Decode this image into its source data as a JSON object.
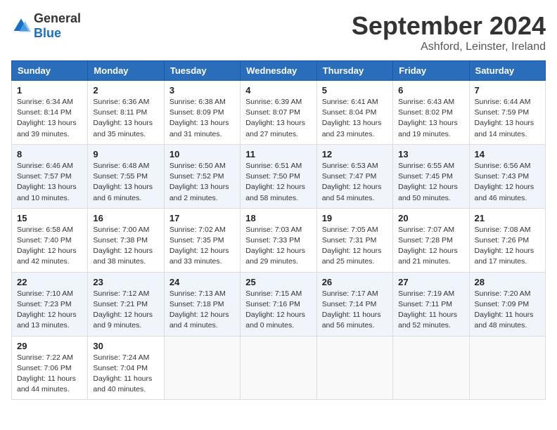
{
  "header": {
    "logo_general": "General",
    "logo_blue": "Blue",
    "title": "September 2024",
    "location": "Ashford, Leinster, Ireland"
  },
  "calendar": {
    "days_of_week": [
      "Sunday",
      "Monday",
      "Tuesday",
      "Wednesday",
      "Thursday",
      "Friday",
      "Saturday"
    ],
    "weeks": [
      [
        {
          "day": "1",
          "info": "Sunrise: 6:34 AM\nSunset: 8:14 PM\nDaylight: 13 hours\nand 39 minutes."
        },
        {
          "day": "2",
          "info": "Sunrise: 6:36 AM\nSunset: 8:11 PM\nDaylight: 13 hours\nand 35 minutes."
        },
        {
          "day": "3",
          "info": "Sunrise: 6:38 AM\nSunset: 8:09 PM\nDaylight: 13 hours\nand 31 minutes."
        },
        {
          "day": "4",
          "info": "Sunrise: 6:39 AM\nSunset: 8:07 PM\nDaylight: 13 hours\nand 27 minutes."
        },
        {
          "day": "5",
          "info": "Sunrise: 6:41 AM\nSunset: 8:04 PM\nDaylight: 13 hours\nand 23 minutes."
        },
        {
          "day": "6",
          "info": "Sunrise: 6:43 AM\nSunset: 8:02 PM\nDaylight: 13 hours\nand 19 minutes."
        },
        {
          "day": "7",
          "info": "Sunrise: 6:44 AM\nSunset: 7:59 PM\nDaylight: 13 hours\nand 14 minutes."
        }
      ],
      [
        {
          "day": "8",
          "info": "Sunrise: 6:46 AM\nSunset: 7:57 PM\nDaylight: 13 hours\nand 10 minutes."
        },
        {
          "day": "9",
          "info": "Sunrise: 6:48 AM\nSunset: 7:55 PM\nDaylight: 13 hours\nand 6 minutes."
        },
        {
          "day": "10",
          "info": "Sunrise: 6:50 AM\nSunset: 7:52 PM\nDaylight: 13 hours\nand 2 minutes."
        },
        {
          "day": "11",
          "info": "Sunrise: 6:51 AM\nSunset: 7:50 PM\nDaylight: 12 hours\nand 58 minutes."
        },
        {
          "day": "12",
          "info": "Sunrise: 6:53 AM\nSunset: 7:47 PM\nDaylight: 12 hours\nand 54 minutes."
        },
        {
          "day": "13",
          "info": "Sunrise: 6:55 AM\nSunset: 7:45 PM\nDaylight: 12 hours\nand 50 minutes."
        },
        {
          "day": "14",
          "info": "Sunrise: 6:56 AM\nSunset: 7:43 PM\nDaylight: 12 hours\nand 46 minutes."
        }
      ],
      [
        {
          "day": "15",
          "info": "Sunrise: 6:58 AM\nSunset: 7:40 PM\nDaylight: 12 hours\nand 42 minutes."
        },
        {
          "day": "16",
          "info": "Sunrise: 7:00 AM\nSunset: 7:38 PM\nDaylight: 12 hours\nand 38 minutes."
        },
        {
          "day": "17",
          "info": "Sunrise: 7:02 AM\nSunset: 7:35 PM\nDaylight: 12 hours\nand 33 minutes."
        },
        {
          "day": "18",
          "info": "Sunrise: 7:03 AM\nSunset: 7:33 PM\nDaylight: 12 hours\nand 29 minutes."
        },
        {
          "day": "19",
          "info": "Sunrise: 7:05 AM\nSunset: 7:31 PM\nDaylight: 12 hours\nand 25 minutes."
        },
        {
          "day": "20",
          "info": "Sunrise: 7:07 AM\nSunset: 7:28 PM\nDaylight: 12 hours\nand 21 minutes."
        },
        {
          "day": "21",
          "info": "Sunrise: 7:08 AM\nSunset: 7:26 PM\nDaylight: 12 hours\nand 17 minutes."
        }
      ],
      [
        {
          "day": "22",
          "info": "Sunrise: 7:10 AM\nSunset: 7:23 PM\nDaylight: 12 hours\nand 13 minutes."
        },
        {
          "day": "23",
          "info": "Sunrise: 7:12 AM\nSunset: 7:21 PM\nDaylight: 12 hours\nand 9 minutes."
        },
        {
          "day": "24",
          "info": "Sunrise: 7:13 AM\nSunset: 7:18 PM\nDaylight: 12 hours\nand 4 minutes."
        },
        {
          "day": "25",
          "info": "Sunrise: 7:15 AM\nSunset: 7:16 PM\nDaylight: 12 hours\nand 0 minutes."
        },
        {
          "day": "26",
          "info": "Sunrise: 7:17 AM\nSunset: 7:14 PM\nDaylight: 11 hours\nand 56 minutes."
        },
        {
          "day": "27",
          "info": "Sunrise: 7:19 AM\nSunset: 7:11 PM\nDaylight: 11 hours\nand 52 minutes."
        },
        {
          "day": "28",
          "info": "Sunrise: 7:20 AM\nSunset: 7:09 PM\nDaylight: 11 hours\nand 48 minutes."
        }
      ],
      [
        {
          "day": "29",
          "info": "Sunrise: 7:22 AM\nSunset: 7:06 PM\nDaylight: 11 hours\nand 44 minutes."
        },
        {
          "day": "30",
          "info": "Sunrise: 7:24 AM\nSunset: 7:04 PM\nDaylight: 11 hours\nand 40 minutes."
        },
        {
          "day": "",
          "info": ""
        },
        {
          "day": "",
          "info": ""
        },
        {
          "day": "",
          "info": ""
        },
        {
          "day": "",
          "info": ""
        },
        {
          "day": "",
          "info": ""
        }
      ]
    ]
  }
}
